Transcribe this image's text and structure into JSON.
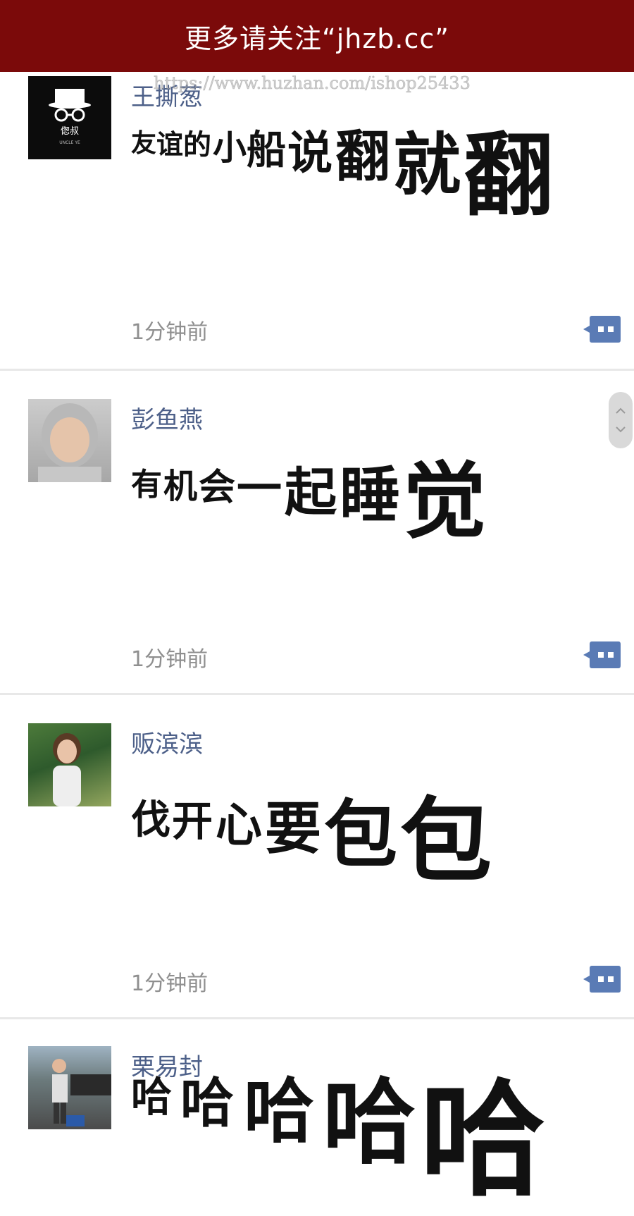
{
  "banner": {
    "text": "更多请关注“jhzb.cc”"
  },
  "watermark": {
    "text": "https://www.huzhan.com/ishop25433"
  },
  "posts": [
    {
      "username": "王撕葱",
      "timestamp": "1分钟前",
      "content": [
        "友",
        "谊",
        "的",
        "小",
        "船",
        "说",
        "翻",
        "就",
        "翻"
      ],
      "avatar_label": "偬叔",
      "avatar_sublabel": "UNCLE YE"
    },
    {
      "username": "彭鱼燕",
      "timestamp": "1分钟前",
      "content": [
        "有",
        "机",
        "会",
        "一",
        "起",
        "睡",
        "觉"
      ]
    },
    {
      "username": "贩滨滨",
      "timestamp": "1分钟前",
      "content": [
        "伐",
        "开",
        "心",
        "要",
        "包",
        "包"
      ]
    },
    {
      "username": "栗易封",
      "timestamp": "",
      "content": [
        "哈",
        "哈",
        "哈",
        "哈",
        "哈"
      ]
    }
  ],
  "colors": {
    "banner": "#7b0a0a",
    "username": "#4d6089",
    "timestamp": "#8f8f8f",
    "comment_icon": "#5a7bb5"
  },
  "icons": [
    "comment-icon",
    "scroll-up-icon",
    "scroll-down-icon"
  ]
}
